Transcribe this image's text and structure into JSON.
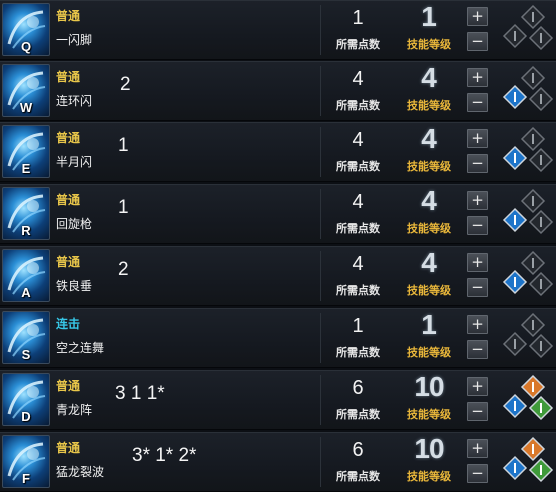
{
  "labels": {
    "points": "所需点数",
    "level": "技能等级",
    "plus": "+",
    "minus": "−"
  },
  "skills": [
    {
      "key": "Q",
      "type": "普通",
      "combo": false,
      "name": "一闪脚",
      "note": "",
      "points": "1",
      "level": "1",
      "runes": 0
    },
    {
      "key": "W",
      "type": "普通",
      "combo": false,
      "name": "连环闪",
      "note": "2",
      "points": "4",
      "level": "4",
      "runes": 1
    },
    {
      "key": "E",
      "type": "普通",
      "combo": false,
      "name": "半月闪",
      "note": "1",
      "points": "4",
      "level": "4",
      "runes": 1
    },
    {
      "key": "R",
      "type": "普通",
      "combo": false,
      "name": "回旋枪",
      "note": "1",
      "points": "4",
      "level": "4",
      "runes": 1
    },
    {
      "key": "A",
      "type": "普通",
      "combo": false,
      "name": "铁良垂",
      "note": "2",
      "points": "4",
      "level": "4",
      "runes": 1
    },
    {
      "key": "S",
      "type": "连击",
      "combo": true,
      "name": "空之连舞",
      "note": "",
      "points": "1",
      "level": "1",
      "runes": 0
    },
    {
      "key": "D",
      "type": "普通",
      "combo": false,
      "name": "青龙阵",
      "note": "3 1 1*",
      "points": "6",
      "level": "10",
      "runes": 3
    },
    {
      "key": "F",
      "type": "普通",
      "combo": false,
      "name": "猛龙裂波",
      "note": "3* 1* 2*",
      "points": "6",
      "level": "10",
      "runes": 3
    }
  ],
  "colors": {
    "type_normal": "#e8c64a",
    "type_combo": "#37c8e8",
    "level_label": "#e8b63a",
    "rune_blue": "#1d74c9",
    "rune_orange": "#d9782a",
    "rune_green": "#3f9a3a",
    "rune_empty": "#5a5e64"
  },
  "icons": [
    "skill-icon",
    "rune-slot-icon"
  ]
}
